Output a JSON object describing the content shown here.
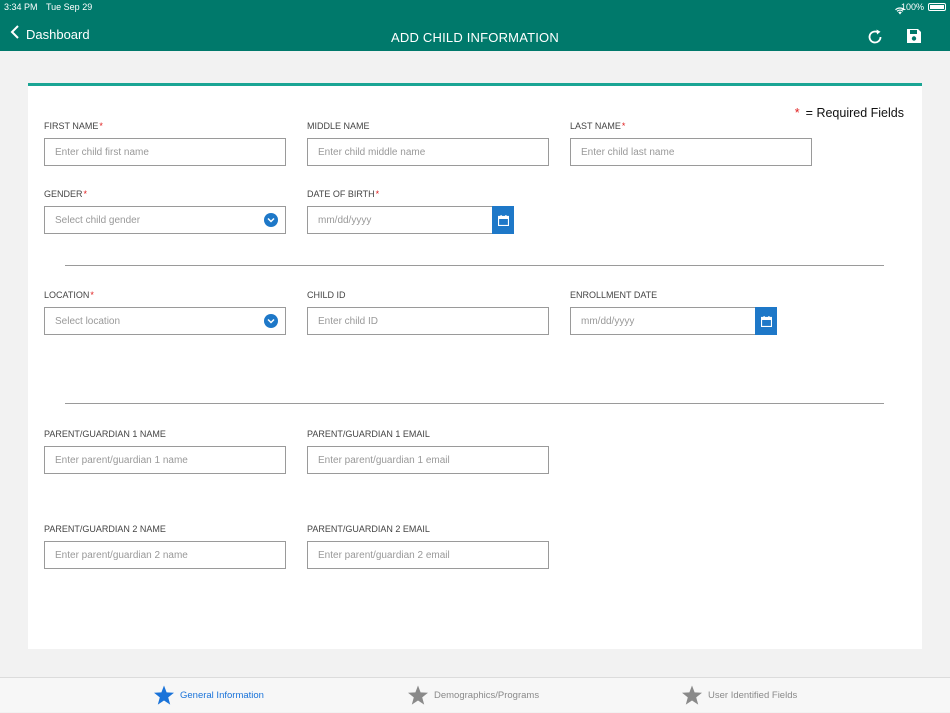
{
  "status_bar": {
    "time": "3:34 PM",
    "date": "Tue Sep 29",
    "battery": "100%"
  },
  "header": {
    "back_label": "Dashboard",
    "title": "ADD CHILD INFORMATION"
  },
  "required_note": {
    "star": "*",
    "text": "= Required Fields"
  },
  "fields": {
    "first_name": {
      "label": "FIRST NAME",
      "placeholder": "Enter child first name",
      "required": "*"
    },
    "middle_name": {
      "label": "MIDDLE NAME",
      "placeholder": "Enter child middle name"
    },
    "last_name": {
      "label": "LAST NAME",
      "placeholder": "Enter child last name",
      "required": "*"
    },
    "gender": {
      "label": "GENDER",
      "placeholder": "Select child gender",
      "required": "*"
    },
    "dob": {
      "label": "DATE OF BIRTH",
      "placeholder": "mm/dd/yyyy",
      "required": "*"
    },
    "location": {
      "label": "LOCATION",
      "placeholder": "Select location",
      "required": "*"
    },
    "child_id": {
      "label": "CHILD ID",
      "placeholder": "Enter child ID"
    },
    "enrollment_date": {
      "label": "ENROLLMENT DATE",
      "placeholder": "mm/dd/yyyy"
    },
    "pg1_name": {
      "label": "PARENT/GUARDIAN 1 NAME",
      "placeholder": "Enter parent/guardian 1 name"
    },
    "pg1_email": {
      "label": "PARENT/GUARDIAN 1 EMAIL",
      "placeholder": "Enter parent/guardian 1 email"
    },
    "pg2_name": {
      "label": "PARENT/GUARDIAN 2 NAME",
      "placeholder": "Enter parent/guardian 2 name"
    },
    "pg2_email": {
      "label": "PARENT/GUARDIAN 2 EMAIL",
      "placeholder": "Enter parent/guardian 2 email"
    }
  },
  "tabs": [
    {
      "label": "General Information",
      "active": true
    },
    {
      "label": "Demographics/Programs",
      "active": false
    },
    {
      "label": "User Identified Fields",
      "active": false
    }
  ],
  "colors": {
    "header": "#00796b",
    "accent_line": "#1aa594",
    "control_blue": "#1e78c8",
    "active_tab": "#1a73d9",
    "required": "#e02020"
  },
  "icons": [
    "wifi-icon",
    "battery-icon",
    "chevron-left-icon",
    "refresh-icon",
    "save-icon",
    "chevron-down-icon",
    "calendar-icon",
    "star-icon"
  ]
}
